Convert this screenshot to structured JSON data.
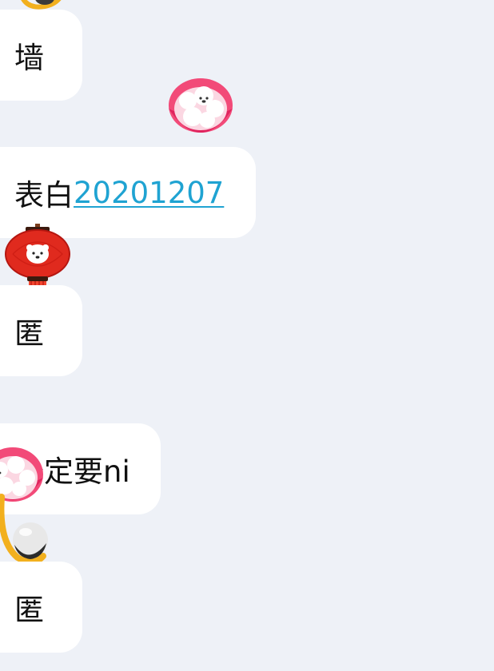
{
  "chat": {
    "messages": [
      {
        "text": "墙"
      },
      {
        "prefix": "表白",
        "link": "20201207"
      },
      {
        "text": "匿"
      },
      {
        "text": "一定要ni"
      },
      {
        "text": "匿"
      }
    ]
  },
  "stickers": [
    {
      "icon": "glutinous-rice-ball-bowl-icon"
    },
    {
      "icon": "red-lantern-icon"
    },
    {
      "icon": "glutinous-rice-ball-bowl-icon"
    },
    {
      "icon": "spoon-with-rice-ball-icon"
    },
    {
      "icon": "spoon-with-rice-ball-icon"
    }
  ],
  "colors": {
    "background": "#EEF1F7",
    "bubble": "#FFFFFF",
    "link": "#1FA3D2",
    "text": "#111111"
  }
}
